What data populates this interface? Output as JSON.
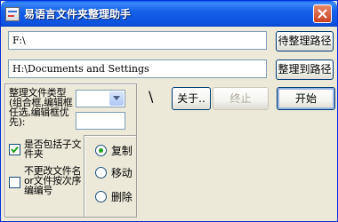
{
  "window": {
    "title": "易语言文件夹整理助手"
  },
  "paths": {
    "source_value": "F:\\",
    "target_value": "H:\\Documents and Settings",
    "source_button": "待整理路径",
    "target_button": "整理到路径"
  },
  "options": {
    "sort_type_label": "整理文件类型(组合框,编辑框任选,编辑框优先):",
    "sort_type_selected": "",
    "sort_type_text": "",
    "include_subfolders_label": "是否包括子文件夹",
    "include_subfolders_checked": true,
    "keep_name_label": "不更改文件名or文件按次序编编号",
    "keep_name_checked": false,
    "mode": {
      "copy": "复制",
      "move": "移动",
      "delete": "删除",
      "selected": "copy"
    }
  },
  "actions": {
    "separator": "\\",
    "about": "关于..",
    "stop": "终止",
    "start": "开始"
  }
}
